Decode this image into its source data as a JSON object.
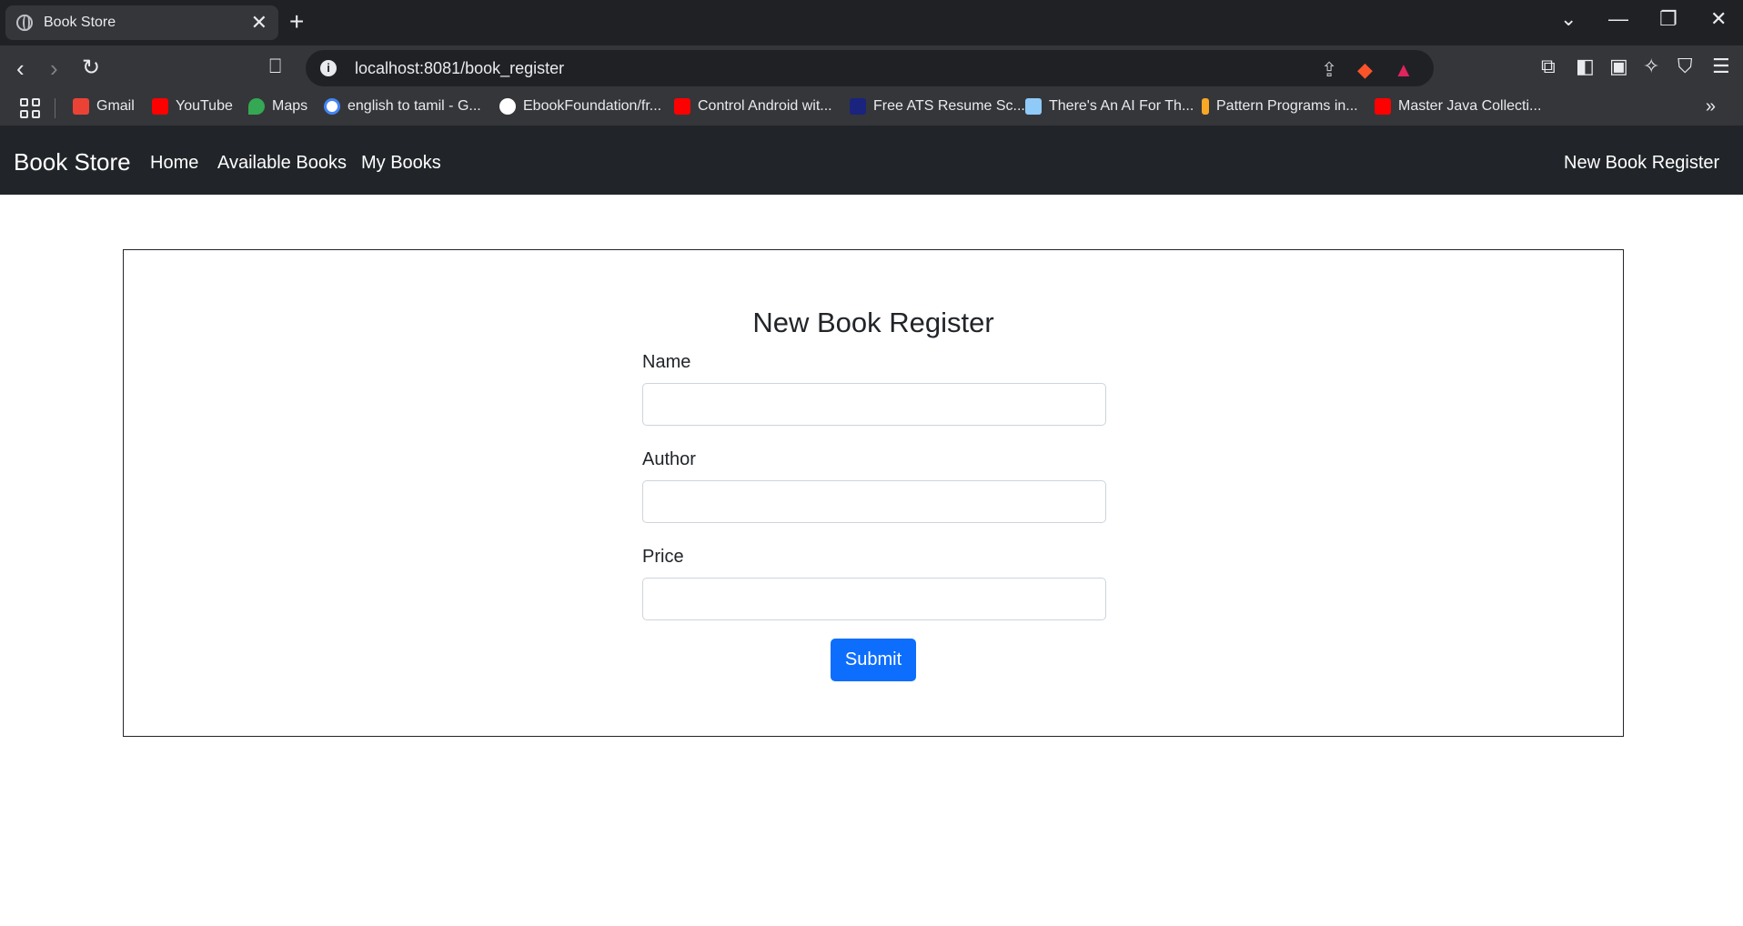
{
  "browser": {
    "tab_title": "Book Store",
    "tab_close": "✕",
    "new_tab": "+",
    "url": "localhost:8081/book_register",
    "window_controls": [
      "⌄",
      "—",
      "❐",
      "✕"
    ],
    "bookmarks": [
      {
        "label": "Gmail",
        "color": "#ea4335"
      },
      {
        "label": "YouTube",
        "color": "#ff0000"
      },
      {
        "label": "Maps",
        "color": "#34a853"
      },
      {
        "label": "english to tamil - G...",
        "color": "#4285f4"
      },
      {
        "label": "EbookFoundation/fr...",
        "color": "#ffffff"
      },
      {
        "label": "Control Android wit...",
        "color": "#ff0000"
      },
      {
        "label": "Free ATS Resume Sc...",
        "color": "#1a237e"
      },
      {
        "label": "There's An AI For Th...",
        "color": "#90caf9"
      },
      {
        "label": "Pattern Programs in...",
        "color": "#f9a825"
      },
      {
        "label": "Master Java Collecti...",
        "color": "#ff0000"
      }
    ]
  },
  "navbar": {
    "brand": "Book Store",
    "links": [
      "Home",
      "Available Books",
      "My Books"
    ],
    "right_link": "New Book Register"
  },
  "form": {
    "heading": "New Book Register",
    "fields": [
      {
        "label": "Name",
        "value": ""
      },
      {
        "label": "Author",
        "value": ""
      },
      {
        "label": "Price",
        "value": ""
      }
    ],
    "submit_label": "Submit",
    "submit_color": "#0d6efd"
  }
}
